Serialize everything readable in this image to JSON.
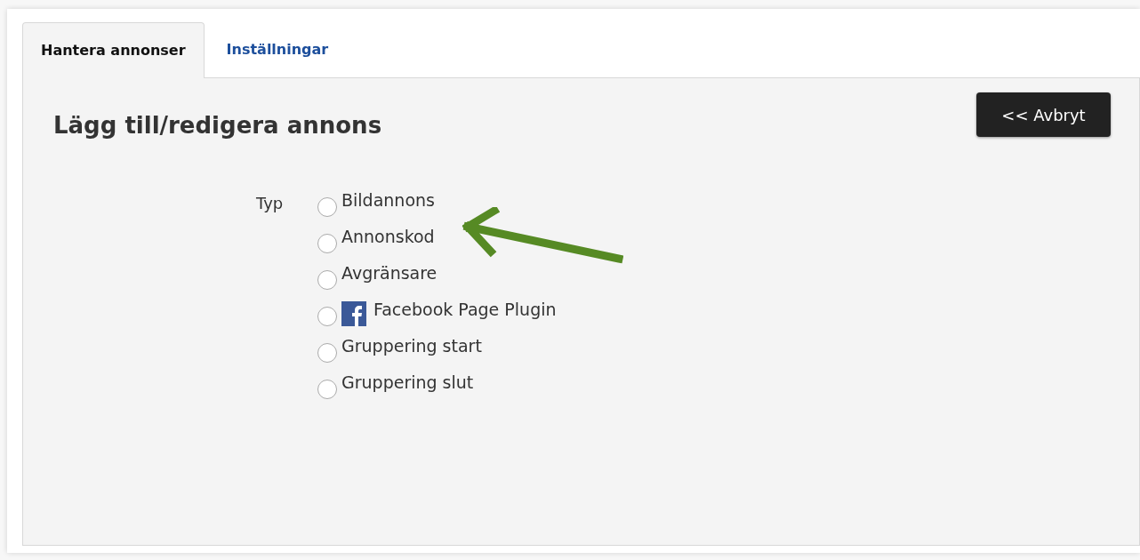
{
  "tabs": [
    {
      "label": "Hantera annonser",
      "selected": true
    },
    {
      "label": "Inställningar",
      "selected": false
    }
  ],
  "panel": {
    "title": "Lägg till/redigera annons",
    "cancel_button": "<< Avbryt"
  },
  "type_field": {
    "label": "Typ",
    "options": [
      {
        "label": "Bildannons",
        "kind": "plain",
        "selected": false
      },
      {
        "label": "Annonskod",
        "kind": "plain",
        "selected": false
      },
      {
        "label": "Avgränsare",
        "kind": "plain",
        "selected": false
      },
      {
        "label": "Facebook Page Plugin",
        "kind": "facebook",
        "selected": false
      },
      {
        "label": "Gruppering start",
        "kind": "plain",
        "selected": false
      },
      {
        "label": "Gruppering slut",
        "kind": "plain",
        "selected": false
      }
    ]
  }
}
